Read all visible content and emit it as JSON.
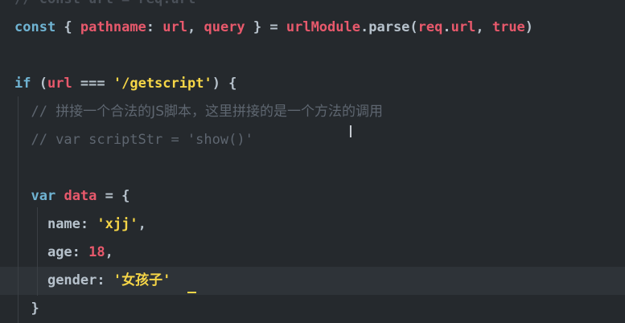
{
  "editor": {
    "lines": [
      {
        "id": "l0",
        "tokens": [
          {
            "t": "// const url = req.url",
            "c": "tok-faded"
          }
        ]
      },
      {
        "id": "l1",
        "tokens": [
          {
            "t": "const",
            "c": "tok-kw"
          },
          {
            "t": " { ",
            "c": "tok-plain"
          },
          {
            "t": "pathname",
            "c": "tok-var"
          },
          {
            "t": ": ",
            "c": "tok-plain"
          },
          {
            "t": "url",
            "c": "tok-var"
          },
          {
            "t": ", ",
            "c": "tok-plain"
          },
          {
            "t": "query",
            "c": "tok-var"
          },
          {
            "t": " } = ",
            "c": "tok-plain"
          },
          {
            "t": "urlModule",
            "c": "tok-var"
          },
          {
            "t": ".",
            "c": "tok-plain"
          },
          {
            "t": "parse",
            "c": "tok-plain"
          },
          {
            "t": "(",
            "c": "tok-plain"
          },
          {
            "t": "req",
            "c": "tok-var"
          },
          {
            "t": ".",
            "c": "tok-plain"
          },
          {
            "t": "url",
            "c": "tok-var"
          },
          {
            "t": ", ",
            "c": "tok-plain"
          },
          {
            "t": "true",
            "c": "tok-var"
          },
          {
            "t": ")",
            "c": "tok-plain"
          }
        ]
      },
      {
        "id": "l2",
        "tokens": []
      },
      {
        "id": "l3",
        "tokens": [
          {
            "t": "if",
            "c": "tok-kw"
          },
          {
            "t": " (",
            "c": "tok-plain"
          },
          {
            "t": "url",
            "c": "tok-var"
          },
          {
            "t": " === ",
            "c": "tok-plain"
          },
          {
            "t": "'/getscript'",
            "c": "tok-str"
          },
          {
            "t": ") {",
            "c": "tok-plain"
          }
        ]
      },
      {
        "id": "l4",
        "tokens": [
          {
            "t": "  // ",
            "c": "tok-cmt"
          },
          {
            "t": "拼接一个合法的JS脚本，这里拼接的是一个方法的调用",
            "c": "tok-cmt cjk"
          }
        ]
      },
      {
        "id": "l5",
        "tokens": [
          {
            "t": "  // var scriptStr = 'show()'",
            "c": "tok-cmt"
          }
        ]
      },
      {
        "id": "l6",
        "tokens": []
      },
      {
        "id": "l7",
        "tokens": [
          {
            "t": "  ",
            "c": "tok-plain"
          },
          {
            "t": "var",
            "c": "tok-kw"
          },
          {
            "t": " ",
            "c": "tok-plain"
          },
          {
            "t": "data",
            "c": "tok-var"
          },
          {
            "t": " = {",
            "c": "tok-plain"
          }
        ]
      },
      {
        "id": "l8",
        "tokens": [
          {
            "t": "    ",
            "c": "tok-plain"
          },
          {
            "t": "name",
            "c": "tok-prop"
          },
          {
            "t": ": ",
            "c": "tok-plain"
          },
          {
            "t": "'xjj'",
            "c": "tok-str"
          },
          {
            "t": ",",
            "c": "tok-plain"
          }
        ]
      },
      {
        "id": "l9",
        "tokens": [
          {
            "t": "    ",
            "c": "tok-plain"
          },
          {
            "t": "age",
            "c": "tok-prop"
          },
          {
            "t": ": ",
            "c": "tok-plain"
          },
          {
            "t": "18",
            "c": "tok-num"
          },
          {
            "t": ",",
            "c": "tok-plain"
          }
        ]
      },
      {
        "id": "l10",
        "current": true,
        "tokens": [
          {
            "t": "    ",
            "c": "tok-plain"
          },
          {
            "t": "gender",
            "c": "tok-prop"
          },
          {
            "t": ": ",
            "c": "tok-plain"
          },
          {
            "t": "'",
            "c": "tok-str"
          },
          {
            "t": "女孩子",
            "c": "tok-str cjk"
          },
          {
            "t": "'",
            "c": "tok-str"
          }
        ]
      },
      {
        "id": "l11",
        "tokens": [
          {
            "t": "  }",
            "c": "tok-plain"
          }
        ]
      }
    ]
  },
  "colors": {
    "background": "#25292d",
    "current_line": "#2e3338",
    "keyword": "#6fb3d2",
    "variable": "#e8596c",
    "string": "#f5d547",
    "comment": "#5e6670",
    "cursor": "#f5d547"
  }
}
